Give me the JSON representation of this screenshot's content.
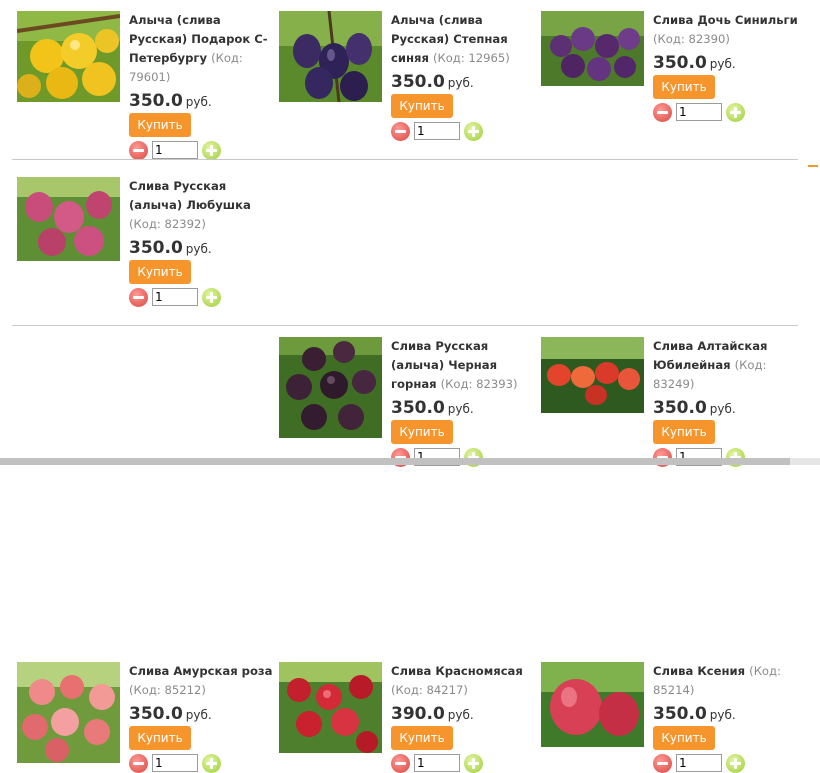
{
  "currency": "руб.",
  "buy_label": "Купить",
  "products": [
    {
      "name": "Алыча (слива Русская) Подарок С-Петербургу",
      "code": "(Код: 79601)",
      "price": "350.0",
      "qty": "1",
      "image": "yellow-plums"
    },
    {
      "name": "Алыча (слива Русская) Степная синяя",
      "code": "(Код: 12965)",
      "price": "350.0",
      "qty": "1",
      "image": "blue-plums"
    },
    {
      "name": "Слива Дочь Синильги",
      "code": "(Код: 82390)",
      "price": "350.0",
      "qty": "1",
      "image": "purple-plums"
    },
    {
      "name": "Слива Русская (алыча) Любушка",
      "code": "(Код: 82392)",
      "price": "350.0",
      "qty": "1",
      "image": "pink-plums"
    },
    {
      "name": "Слива Русская (алыча) Черная горная",
      "code": "(Код: 82393)",
      "price": "350.0",
      "qty": "1",
      "image": "dark-plums"
    },
    {
      "name": "Слива Алтайская Юбилейная",
      "code": "(Код: 83249)",
      "price": "350.0",
      "qty": "1",
      "image": "red-orange-plums"
    },
    {
      "name": "Слива Амурская роза",
      "code": "(Код: 85212)",
      "price": "350.0",
      "qty": "1",
      "image": "rose-plums"
    },
    {
      "name": "Слива Красномясая",
      "code": "(Код: 84217)",
      "price": "390.0",
      "qty": "1",
      "image": "red-plums"
    },
    {
      "name": "Слива Ксения",
      "code": "(Код: 85214)",
      "price": "350.0",
      "qty": "1",
      "image": "red-plum-closeup"
    }
  ]
}
